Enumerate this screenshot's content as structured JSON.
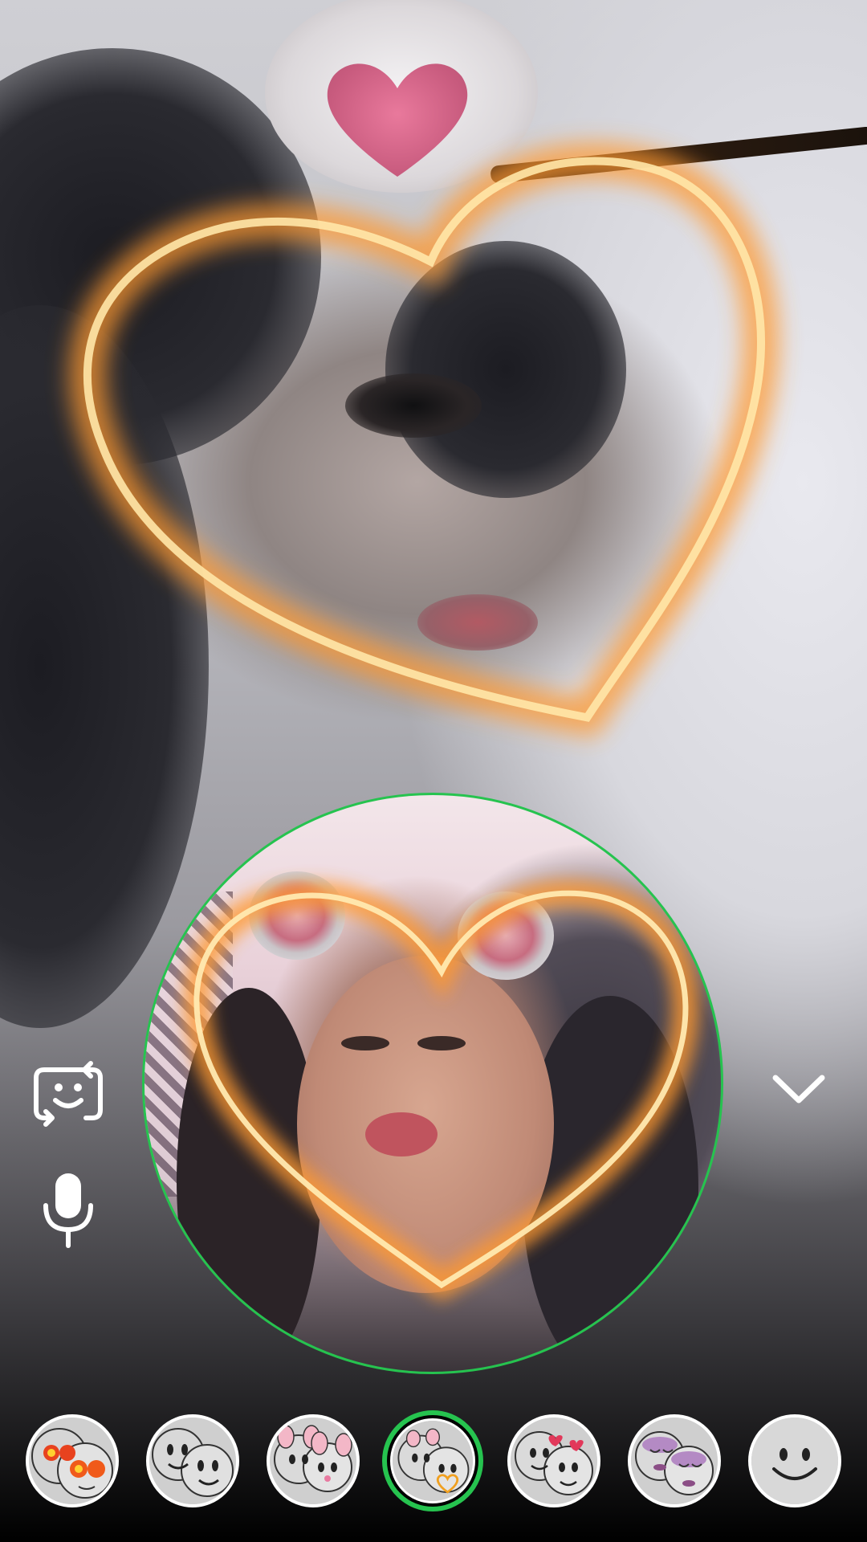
{
  "camera": {
    "flip_icon": "face-flip-icon",
    "mic_icon": "microphone-icon",
    "collapse_icon": "chevron-down-icon"
  },
  "preview": {
    "ring_color": "#26c34f"
  },
  "lenses": [
    {
      "name": "sunglasses-face-lens",
      "icon": "sunglasses-faces-icon",
      "active": false
    },
    {
      "name": "smiley-faces-lens",
      "icon": "smiley-faces-icon",
      "active": false
    },
    {
      "name": "puppy-ears-lens",
      "icon": "puppy-ears-faces-icon",
      "active": false
    },
    {
      "name": "heart-glow-lens",
      "icon": "heart-glow-faces-icon",
      "active": true
    },
    {
      "name": "heart-cheeks-lens",
      "icon": "heart-cheeks-faces-icon",
      "active": false
    },
    {
      "name": "purple-makeup-lens",
      "icon": "purple-makeup-faces-icon",
      "active": false
    },
    {
      "name": "basic-smile-lens",
      "icon": "smile-face-icon",
      "active": false
    }
  ],
  "colors": {
    "accent": "#26c34f",
    "glow": "#ffb14a"
  }
}
